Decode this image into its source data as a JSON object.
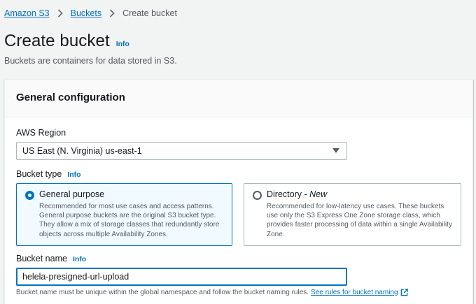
{
  "breadcrumb": {
    "items": [
      "Amazon S3",
      "Buckets"
    ],
    "current": "Create bucket"
  },
  "header": {
    "title": "Create bucket",
    "info": "Info",
    "description": "Buckets are containers for data stored in S3."
  },
  "general_config": {
    "title": "General configuration",
    "region": {
      "label": "AWS Region",
      "value": "US East (N. Virginia) us-east-1"
    },
    "bucket_type": {
      "label": "Bucket type",
      "info": "Info",
      "options": [
        {
          "title": "General purpose",
          "selected": true,
          "description": "Recommended for most use cases and access patterns. General purpose buckets are the original S3 bucket type. They allow a mix of storage classes that redundantly store objects across multiple Availability Zones."
        },
        {
          "title": "Directory - ",
          "title_badge": "New",
          "selected": false,
          "description": "Recommended for low-latency use cases. These buckets use only the S3 Express One Zone storage class, which provides faster processing of data within a single Availability Zone."
        }
      ]
    },
    "bucket_name": {
      "label": "Bucket name",
      "info": "Info",
      "value": "helela-presigned-url-upload",
      "hint": "Bucket name must be unique within the global namespace and follow the bucket naming rules.",
      "rules_link": "See rules for bucket naming"
    }
  },
  "colors": {
    "link": "#0073bb",
    "selected_bg": "#f1faff",
    "page_bg": "#f2f3f3"
  }
}
